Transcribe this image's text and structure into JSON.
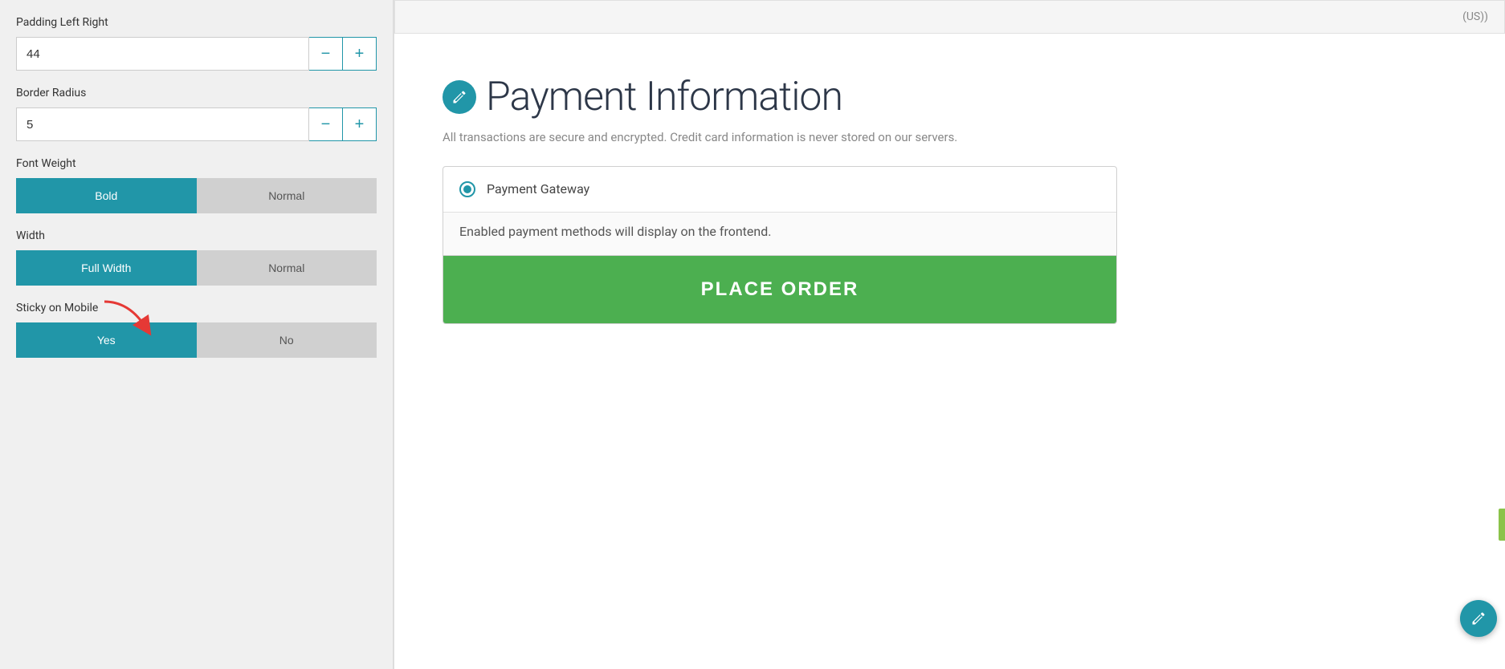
{
  "left_panel": {
    "padding_lr_label": "Padding Left Right",
    "padding_lr_value": "44",
    "border_radius_label": "Border Radius",
    "border_radius_value": "5",
    "font_weight_label": "Font Weight",
    "font_weight_bold": "Bold",
    "font_weight_normal": "Normal",
    "width_label": "Width",
    "width_full": "Full Width",
    "width_normal": "Normal",
    "sticky_mobile_label": "Sticky on Mobile",
    "sticky_yes": "Yes",
    "sticky_no": "No"
  },
  "right_panel": {
    "top_bar_text": "(US))",
    "payment_title": "Payment Information",
    "payment_subtitle": "All transactions are secure and encrypted. Credit card information is never stored on our servers.",
    "payment_gateway_label": "Payment Gateway",
    "payment_info_text": "Enabled payment methods will display on the frontend.",
    "place_order_label": "PLACE ORDER"
  },
  "icons": {
    "minus": "−",
    "plus": "+",
    "edit_pencil": "✏"
  }
}
